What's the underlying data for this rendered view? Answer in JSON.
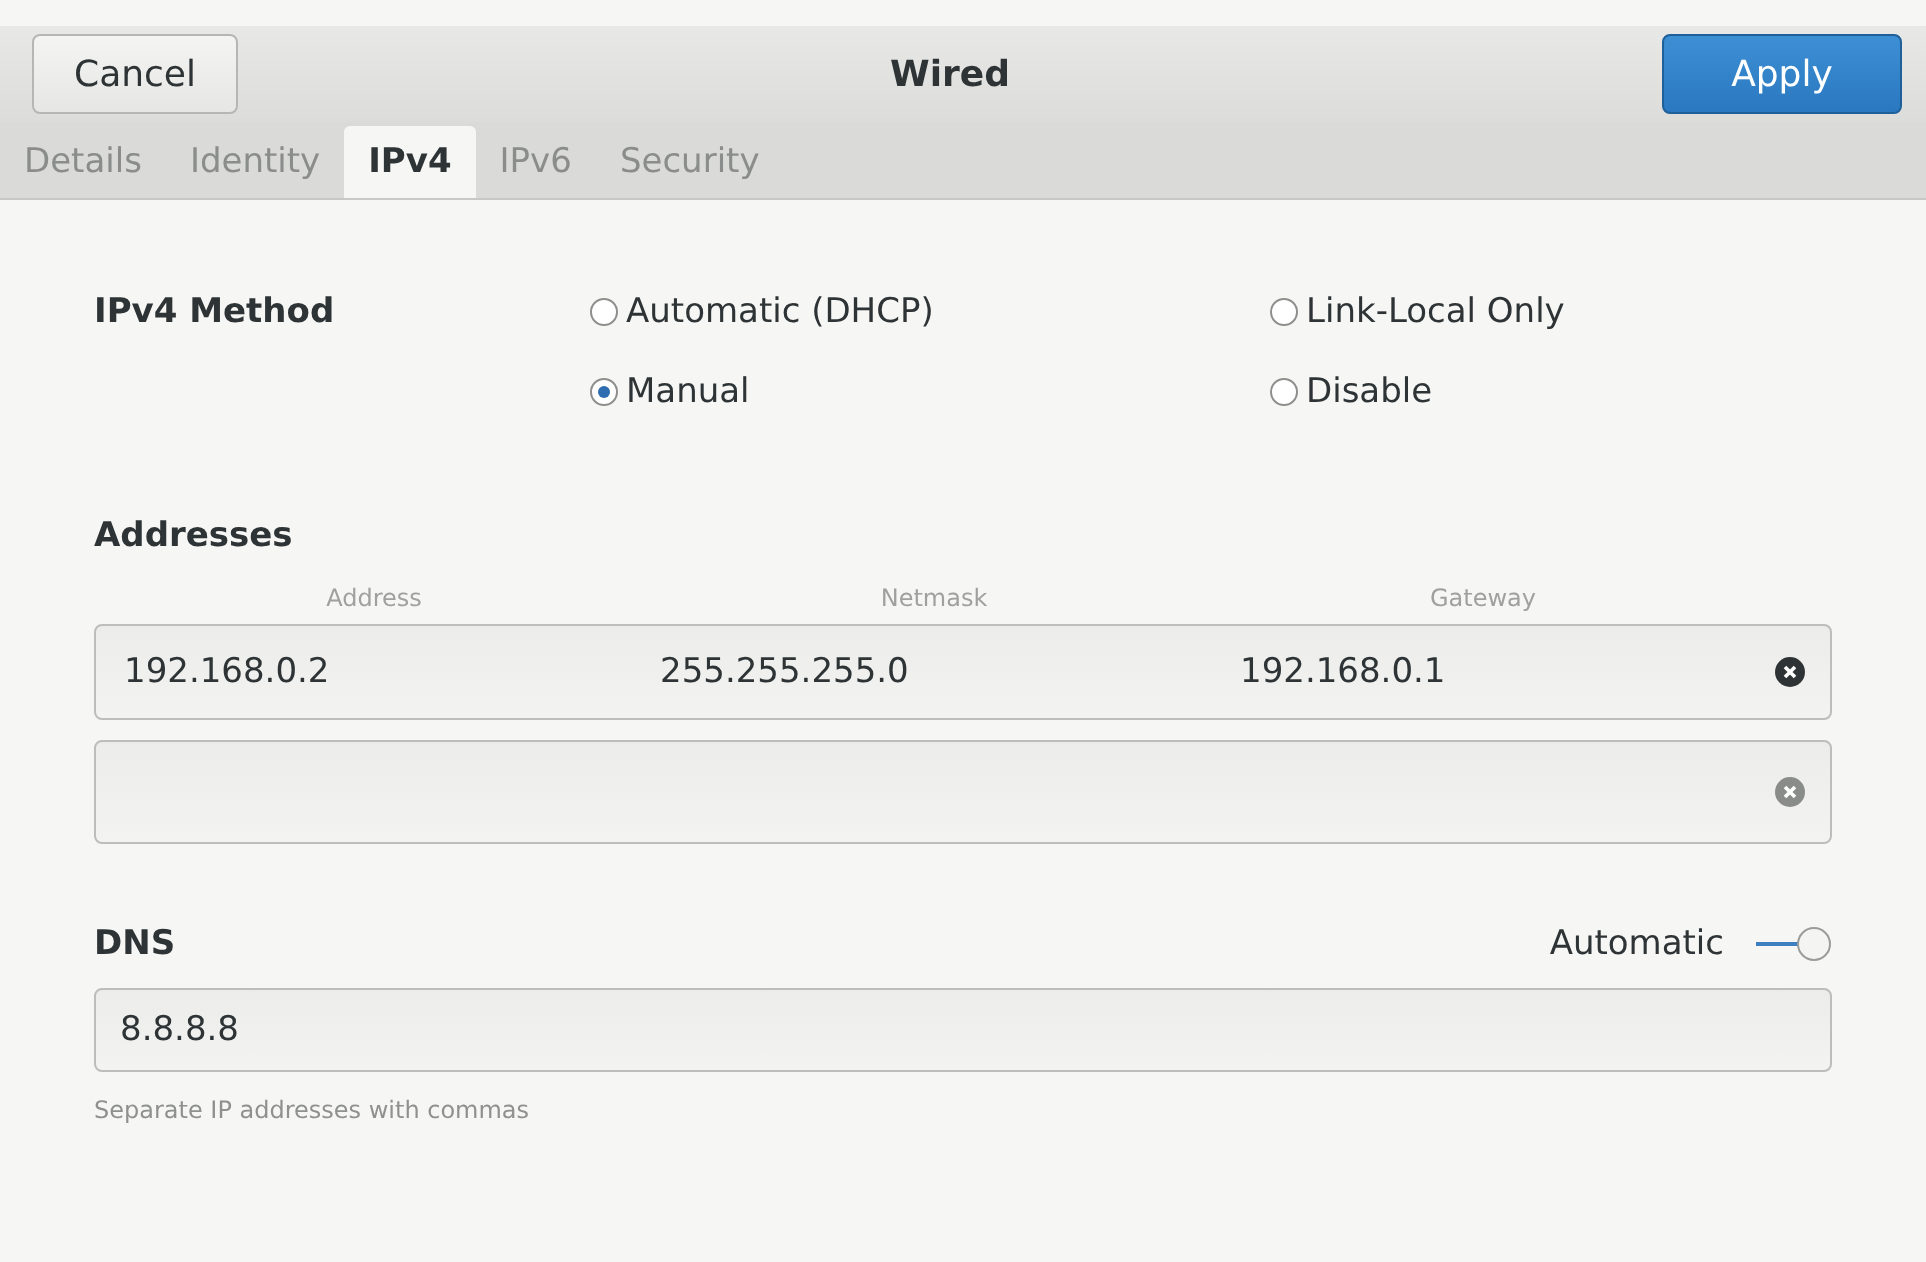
{
  "header": {
    "cancel": "Cancel",
    "title": "Wired",
    "apply": "Apply"
  },
  "tabs": [
    {
      "label": "Details",
      "selected": false
    },
    {
      "label": "Identity",
      "selected": false
    },
    {
      "label": "IPv4",
      "selected": true
    },
    {
      "label": "IPv6",
      "selected": false
    },
    {
      "label": "Security",
      "selected": false
    }
  ],
  "method": {
    "label": "IPv4 Method",
    "options": [
      {
        "label": "Automatic (DHCP)",
        "selected": false
      },
      {
        "label": "Link-Local Only",
        "selected": false
      },
      {
        "label": "Manual",
        "selected": true
      },
      {
        "label": "Disable",
        "selected": false
      }
    ]
  },
  "addresses": {
    "title": "Addresses",
    "columns": [
      "Address",
      "Netmask",
      "Gateway"
    ],
    "rows": [
      {
        "address": "192.168.0.2",
        "netmask": "255.255.255.0",
        "gateway": "192.168.0.1",
        "active": true
      },
      {
        "active": false
      }
    ]
  },
  "dns": {
    "title": "DNS",
    "auto_label": "Automatic",
    "auto_on": true,
    "value": "8.8.8.8",
    "hint": "Separate IP addresses with commas"
  }
}
